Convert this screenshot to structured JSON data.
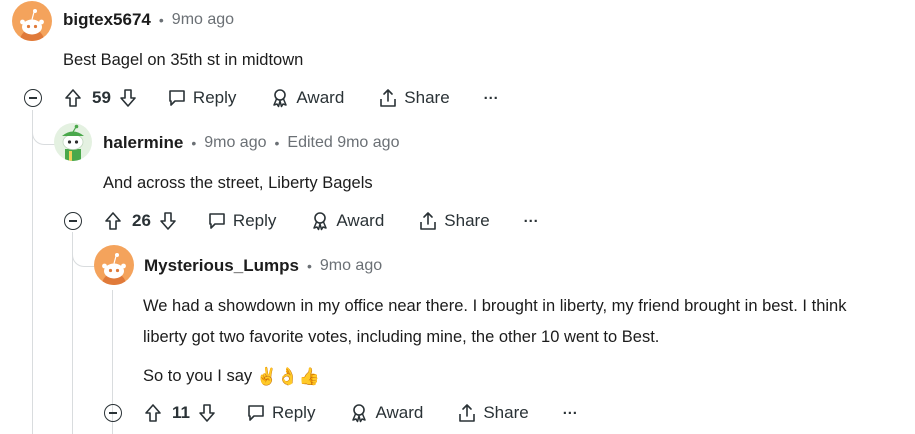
{
  "colors": {
    "text": "#1c1c1c",
    "meta": "#6b7075",
    "line": "#d9dcde",
    "action": "#2a3236",
    "avatar_orange": "#f4a35c"
  },
  "comments": [
    {
      "user": "bigtex5674",
      "meta": "9mo ago",
      "body": [
        "Best Bagel on 35th st in midtown"
      ],
      "votes": "59",
      "avatar_icon": "snoo-avatar-icon"
    },
    {
      "user": "halermine",
      "meta": "9mo ago",
      "edited": "Edited 9mo ago",
      "body": [
        "And across the street, Liberty Bagels"
      ],
      "votes": "26",
      "avatar_icon": "snoo-green-avatar-icon"
    },
    {
      "user": "Mysterious_Lumps",
      "meta": "9mo ago",
      "body": [
        "We had a showdown in my office near there. I brought in liberty, my friend brought in best. I think",
        "liberty got two favorite votes, including mine, the other 10 went to Best.",
        "So to you I say"
      ],
      "emojis": "✌👌👍",
      "votes": "11",
      "avatar_icon": "snoo-avatar-icon"
    }
  ],
  "actions": {
    "reply": "Reply",
    "award": "Award",
    "share": "Share",
    "more": "···"
  }
}
